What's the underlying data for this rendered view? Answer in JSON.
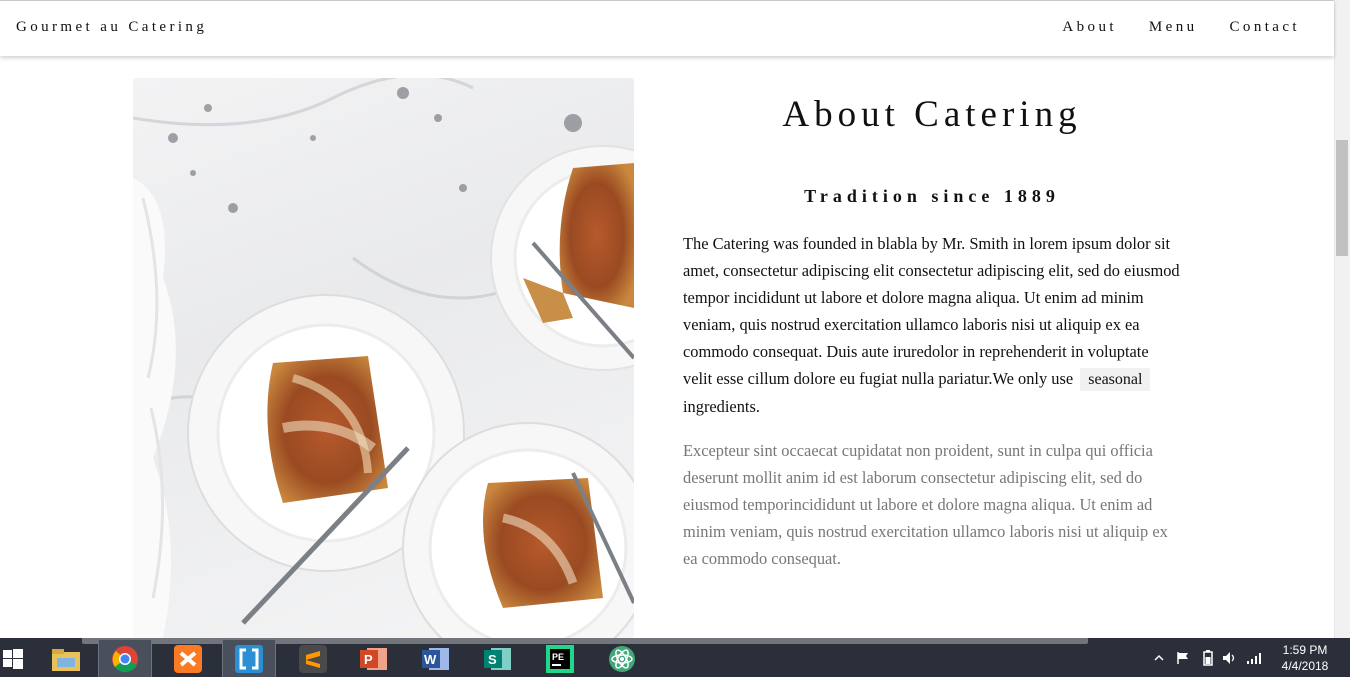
{
  "nav": {
    "brand": "Gourmet au Catering",
    "links": [
      "About",
      "Menu",
      "Contact"
    ]
  },
  "about": {
    "title": "About Catering",
    "subtitle": "Tradition since 1889",
    "para1_before": "The Catering was founded in blabla by Mr. Smith in lorem ipsum dolor sit amet, consectetur adipiscing elit consectetur adipiscing elit, sed do eiusmod tempor incididunt ut labore et dolore magna aliqua. Ut enim ad minim veniam, quis nostrud exercitation ullamco laboris nisi ut aliquip ex ea commodo consequat. Duis aute iruredolor in reprehenderit in voluptate velit esse cillum dolore eu fugiat nulla pariatur.We only use",
    "para1_tag": "seasonal",
    "para1_after": "ingredients.",
    "para2": "Excepteur sint occaecat cupidatat non proident, sunt in culpa qui officia deserunt mollit anim id est laborum consectetur adipiscing elit, sed do eiusmod temporincididunt ut labore et dolore magna aliqua. Ut enim ad minim veniam, quis nostrud exercitation ullamco laboris nisi ut aliquip ex ea commodo consequat."
  },
  "taskbar": {
    "apps": [
      {
        "icon": "file-explorer-icon"
      },
      {
        "icon": "chrome-icon",
        "active": true
      },
      {
        "icon": "xampp-icon"
      },
      {
        "icon": "brackets-icon",
        "active": true
      },
      {
        "icon": "sublime-text-icon"
      },
      {
        "icon": "powerpoint-icon"
      },
      {
        "icon": "word-icon"
      },
      {
        "icon": "sway-icon"
      },
      {
        "icon": "pycharm-edu-icon"
      },
      {
        "icon": "atom-icon"
      }
    ],
    "time": "1:59 PM",
    "date": "4/4/2018"
  },
  "colors": {
    "taskbar": "#2b2f3a",
    "muted_text": "#777777",
    "tag_bg": "#f1f1f1"
  }
}
